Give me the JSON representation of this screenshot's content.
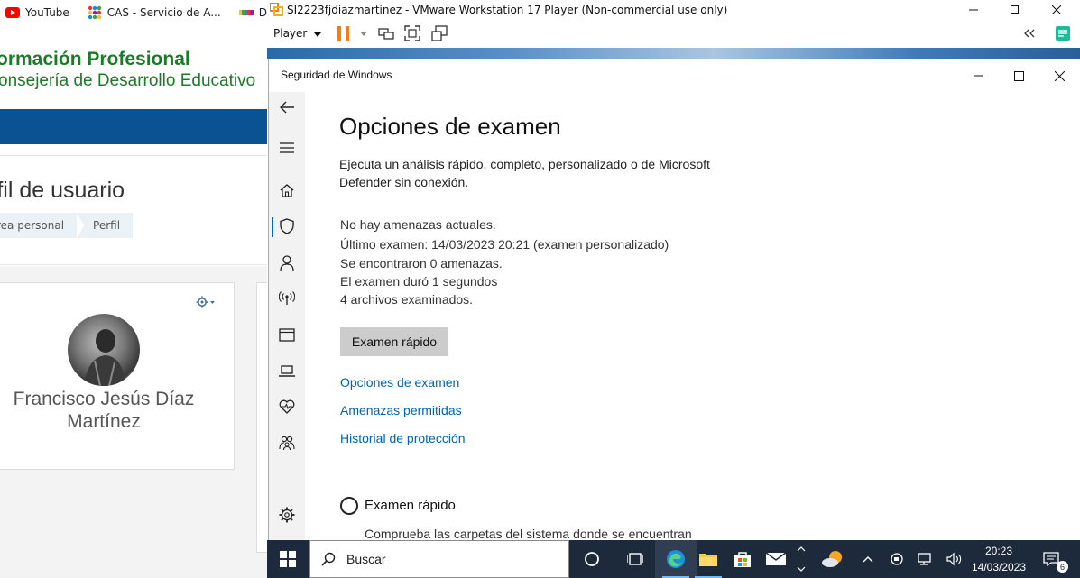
{
  "bookmarks": [
    {
      "label": "YouTube",
      "icon": "youtube-icon"
    },
    {
      "label": "CAS - Servicio de A...",
      "icon": "cas-icon"
    },
    {
      "label": "DALL",
      "icon": "dall-icon"
    }
  ],
  "site": {
    "title_line1": "ormación Profesional",
    "title_line2": "onsejería de Desarrollo Educativo",
    "page_title": "rfil de usuario",
    "breadcrumb": [
      "rea personal",
      "Perfil"
    ],
    "profile_name": "Francisco Jesús Díaz Martínez",
    "nav_color": "#0a5291",
    "brand_color": "#1d7a27"
  },
  "vmware": {
    "title": "SI2223fjdiazmartinez - VMware Workstation 17 Player (Non-commercial use only)",
    "player_menu": "Player",
    "pause_color": "#f07f1b"
  },
  "security": {
    "window_title": "Seguridad de Windows",
    "heading": "Opciones de examen",
    "description": "Ejecuta un análisis rápido, completo, personalizado o de Microsoft Defender sin conexión.",
    "status": [
      "No hay amenazas actuales.",
      "Último examen: 14/03/2023 20:21 (examen personalizado)",
      "Se encontraron 0 amenazas.",
      "El examen duró 1 segundos",
      "4 archivos examinados."
    ],
    "quick_scan_button": "Examen rápido",
    "links": [
      "Opciones de examen",
      "Amenazas permitidas",
      "Historial de protección"
    ],
    "option_quick_label": "Examen rápido",
    "option_quick_desc": "Comprueba las carpetas del sistema donde se encuentran",
    "link_color": "#0063b1"
  },
  "taskbar": {
    "search_placeholder": "Buscar",
    "time": "20:23",
    "date": "14/03/2023",
    "notifications": "6"
  }
}
